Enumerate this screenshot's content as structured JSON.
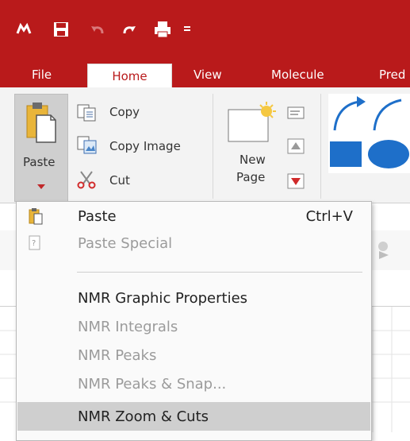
{
  "quick_access": {
    "icons": [
      "app-logo-icon",
      "save-icon",
      "undo-icon",
      "redo-icon",
      "print-icon",
      "customize-qat-icon"
    ]
  },
  "tabs": [
    {
      "label": "File",
      "active": false
    },
    {
      "label": "Home",
      "active": true
    },
    {
      "label": "View",
      "active": false
    },
    {
      "label": "Molecule",
      "active": false
    },
    {
      "label": "Pred",
      "active": false
    }
  ],
  "ribbon": {
    "paste_label": "Paste",
    "copy_label": "Copy",
    "copy_image_label": "Copy Image",
    "cut_label": "Cut",
    "new_page_line1": "New",
    "new_page_line2": "Page"
  },
  "paste_menu": {
    "items": [
      {
        "label": "Paste",
        "shortcut": "Ctrl+V",
        "enabled": true
      },
      {
        "label": "Paste Special",
        "shortcut": "",
        "enabled": false
      },
      {
        "label": "NMR Graphic Properties",
        "shortcut": "",
        "enabled": true
      },
      {
        "label": "NMR Integrals",
        "shortcut": "",
        "enabled": false
      },
      {
        "label": "NMR Peaks",
        "shortcut": "",
        "enabled": false
      },
      {
        "label": "NMR Peaks & Snap...",
        "shortcut": "",
        "enabled": false
      },
      {
        "label": "NMR Zoom & Cuts",
        "shortcut": "",
        "enabled": true,
        "highlighted": true
      }
    ]
  },
  "colors": {
    "title_bar": "#b91a1b",
    "shape_blue": "#1e6fc9",
    "menu_highlight": "#cfcfcf"
  }
}
